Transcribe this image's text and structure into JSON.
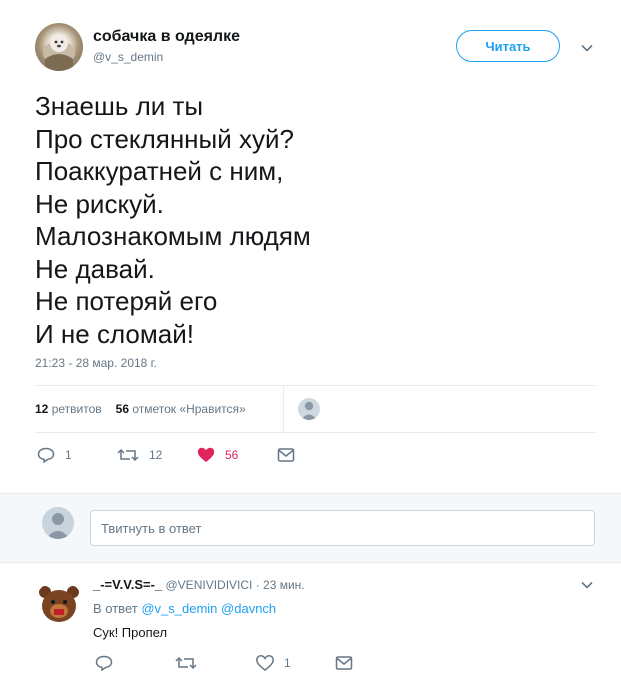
{
  "tweet": {
    "author_name": "собачка в одеялке",
    "author_handle": "@v_s_demin",
    "follow_label": "Читать",
    "lines": [
      "Знаешь ли ты",
      "Про стеклянный хуй?",
      "Поаккуратней с ним,",
      "Не рискуй.",
      "Малознакомым людям",
      "Не давай.",
      "Не потеряй его",
      "И не сломай!"
    ],
    "timestamp": "21:23 - 28 мар. 2018 г.",
    "retweets_count": "12",
    "retweets_label": "ретвитов",
    "likes_count": "56",
    "likes_label": "отметок «Нравится»",
    "actions": {
      "reply_count": "1",
      "retweet_count": "12",
      "like_count": "56"
    },
    "colors": {
      "accent": "#1da1f2",
      "like": "#e0245e",
      "muted": "#657786"
    }
  },
  "reply_box": {
    "placeholder": "Твитнуть в ответ"
  },
  "reply": {
    "name": "_-=V.V.S=-_",
    "handle": "@VENIVIDIVICI",
    "time": "· 23 мин.",
    "in_reply_prefix": "В ответ",
    "mention_1": "@v_s_demin",
    "mention_2": "@davnch",
    "text": "Сук! Пропел",
    "actions": {
      "reply_count": "",
      "retweet_count": "",
      "like_count": "1"
    }
  }
}
